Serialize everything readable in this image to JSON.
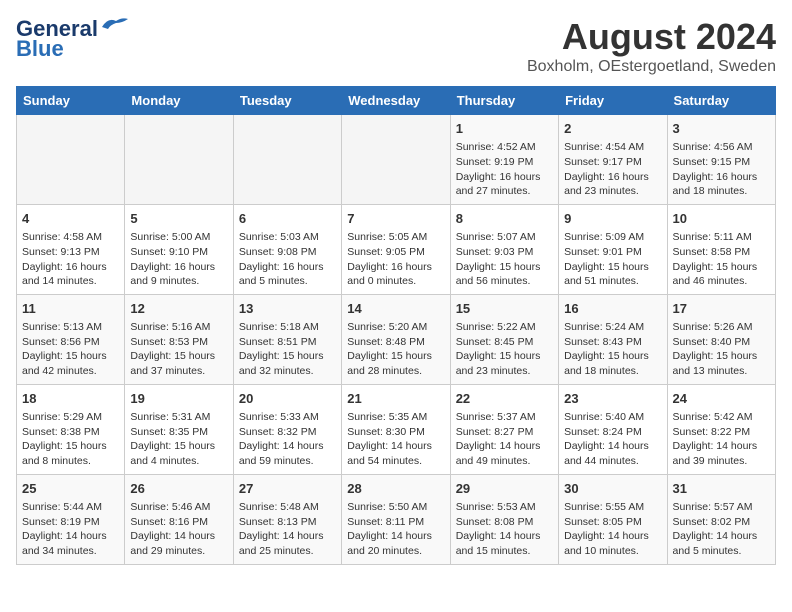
{
  "header": {
    "logo_line1": "General",
    "logo_line2": "Blue",
    "main_title": "August 2024",
    "sub_title": "Boxholm, OEstergoetland, Sweden"
  },
  "days_of_week": [
    "Sunday",
    "Monday",
    "Tuesday",
    "Wednesday",
    "Thursday",
    "Friday",
    "Saturday"
  ],
  "weeks": [
    [
      {
        "num": "",
        "content": ""
      },
      {
        "num": "",
        "content": ""
      },
      {
        "num": "",
        "content": ""
      },
      {
        "num": "",
        "content": ""
      },
      {
        "num": "1",
        "content": "Sunrise: 4:52 AM\nSunset: 9:19 PM\nDaylight: 16 hours and 27 minutes."
      },
      {
        "num": "2",
        "content": "Sunrise: 4:54 AM\nSunset: 9:17 PM\nDaylight: 16 hours and 23 minutes."
      },
      {
        "num": "3",
        "content": "Sunrise: 4:56 AM\nSunset: 9:15 PM\nDaylight: 16 hours and 18 minutes."
      }
    ],
    [
      {
        "num": "4",
        "content": "Sunrise: 4:58 AM\nSunset: 9:13 PM\nDaylight: 16 hours and 14 minutes."
      },
      {
        "num": "5",
        "content": "Sunrise: 5:00 AM\nSunset: 9:10 PM\nDaylight: 16 hours and 9 minutes."
      },
      {
        "num": "6",
        "content": "Sunrise: 5:03 AM\nSunset: 9:08 PM\nDaylight: 16 hours and 5 minutes."
      },
      {
        "num": "7",
        "content": "Sunrise: 5:05 AM\nSunset: 9:05 PM\nDaylight: 16 hours and 0 minutes."
      },
      {
        "num": "8",
        "content": "Sunrise: 5:07 AM\nSunset: 9:03 PM\nDaylight: 15 hours and 56 minutes."
      },
      {
        "num": "9",
        "content": "Sunrise: 5:09 AM\nSunset: 9:01 PM\nDaylight: 15 hours and 51 minutes."
      },
      {
        "num": "10",
        "content": "Sunrise: 5:11 AM\nSunset: 8:58 PM\nDaylight: 15 hours and 46 minutes."
      }
    ],
    [
      {
        "num": "11",
        "content": "Sunrise: 5:13 AM\nSunset: 8:56 PM\nDaylight: 15 hours and 42 minutes."
      },
      {
        "num": "12",
        "content": "Sunrise: 5:16 AM\nSunset: 8:53 PM\nDaylight: 15 hours and 37 minutes."
      },
      {
        "num": "13",
        "content": "Sunrise: 5:18 AM\nSunset: 8:51 PM\nDaylight: 15 hours and 32 minutes."
      },
      {
        "num": "14",
        "content": "Sunrise: 5:20 AM\nSunset: 8:48 PM\nDaylight: 15 hours and 28 minutes."
      },
      {
        "num": "15",
        "content": "Sunrise: 5:22 AM\nSunset: 8:45 PM\nDaylight: 15 hours and 23 minutes."
      },
      {
        "num": "16",
        "content": "Sunrise: 5:24 AM\nSunset: 8:43 PM\nDaylight: 15 hours and 18 minutes."
      },
      {
        "num": "17",
        "content": "Sunrise: 5:26 AM\nSunset: 8:40 PM\nDaylight: 15 hours and 13 minutes."
      }
    ],
    [
      {
        "num": "18",
        "content": "Sunrise: 5:29 AM\nSunset: 8:38 PM\nDaylight: 15 hours and 8 minutes."
      },
      {
        "num": "19",
        "content": "Sunrise: 5:31 AM\nSunset: 8:35 PM\nDaylight: 15 hours and 4 minutes."
      },
      {
        "num": "20",
        "content": "Sunrise: 5:33 AM\nSunset: 8:32 PM\nDaylight: 14 hours and 59 minutes."
      },
      {
        "num": "21",
        "content": "Sunrise: 5:35 AM\nSunset: 8:30 PM\nDaylight: 14 hours and 54 minutes."
      },
      {
        "num": "22",
        "content": "Sunrise: 5:37 AM\nSunset: 8:27 PM\nDaylight: 14 hours and 49 minutes."
      },
      {
        "num": "23",
        "content": "Sunrise: 5:40 AM\nSunset: 8:24 PM\nDaylight: 14 hours and 44 minutes."
      },
      {
        "num": "24",
        "content": "Sunrise: 5:42 AM\nSunset: 8:22 PM\nDaylight: 14 hours and 39 minutes."
      }
    ],
    [
      {
        "num": "25",
        "content": "Sunrise: 5:44 AM\nSunset: 8:19 PM\nDaylight: 14 hours and 34 minutes."
      },
      {
        "num": "26",
        "content": "Sunrise: 5:46 AM\nSunset: 8:16 PM\nDaylight: 14 hours and 29 minutes."
      },
      {
        "num": "27",
        "content": "Sunrise: 5:48 AM\nSunset: 8:13 PM\nDaylight: 14 hours and 25 minutes."
      },
      {
        "num": "28",
        "content": "Sunrise: 5:50 AM\nSunset: 8:11 PM\nDaylight: 14 hours and 20 minutes."
      },
      {
        "num": "29",
        "content": "Sunrise: 5:53 AM\nSunset: 8:08 PM\nDaylight: 14 hours and 15 minutes."
      },
      {
        "num": "30",
        "content": "Sunrise: 5:55 AM\nSunset: 8:05 PM\nDaylight: 14 hours and 10 minutes."
      },
      {
        "num": "31",
        "content": "Sunrise: 5:57 AM\nSunset: 8:02 PM\nDaylight: 14 hours and 5 minutes."
      }
    ]
  ]
}
